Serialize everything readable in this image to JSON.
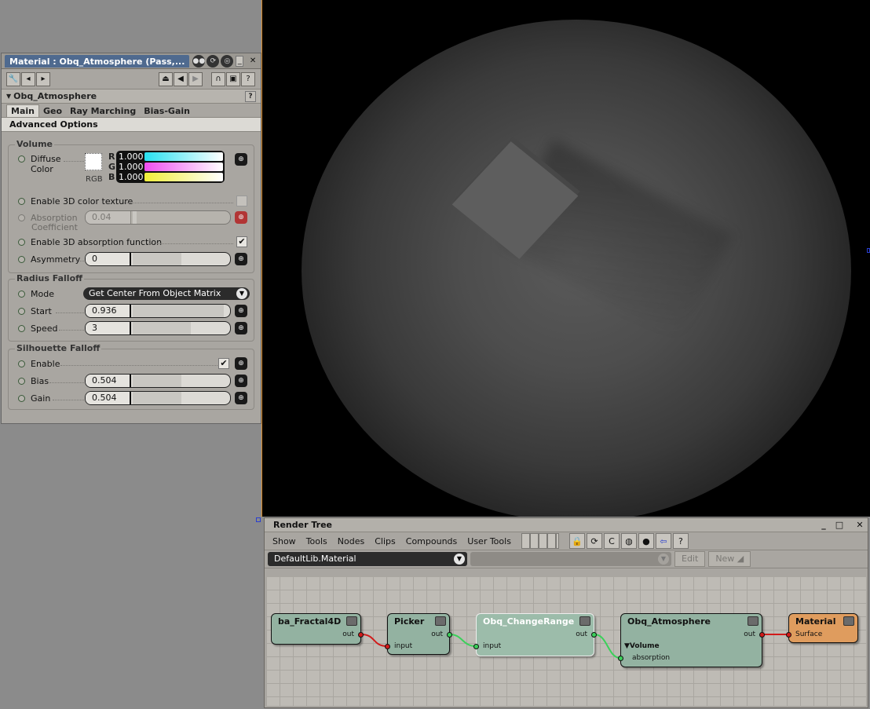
{
  "property_panel": {
    "title": "Material : Obq_Atmosphere (Pass,...",
    "section": "Obq_Atmosphere",
    "tabs": [
      "Main",
      "Geo",
      "Ray Marching",
      "Bias-Gain"
    ],
    "advanced_label": "Advanced Options",
    "volume": {
      "title": "Volume",
      "diffuse_label_1": "Diffuse",
      "diffuse_label_2": "Color",
      "rgb_label": "RGB",
      "channels": [
        {
          "name": "R",
          "value": "1.000",
          "color": "#28e0f0"
        },
        {
          "name": "G",
          "value": "1.000",
          "color": "#ee4ef0"
        },
        {
          "name": "B",
          "value": "1.000",
          "color": "#f0ee38"
        }
      ],
      "enable_3d_texture_label": "Enable 3D color texture",
      "enable_3d_texture_checked": false,
      "absorption_label_1": "Absorption",
      "absorption_label_2": "Coefficient",
      "absorption_value": "0.04",
      "absorption_fraction": 0.04,
      "enable_3d_absorption_label": "Enable 3D absorption function",
      "enable_3d_absorption_checked": true,
      "asymmetry_label": "Asymmetry",
      "asymmetry_value": "0",
      "asymmetry_fraction": 0.5
    },
    "radius_falloff": {
      "title": "Radius Falloff",
      "mode_label": "Mode",
      "mode_value": "Get Center From Object Matrix",
      "start_label": "Start",
      "start_value": "0.936",
      "start_fraction": 0.936,
      "speed_label": "Speed",
      "speed_value": "3",
      "speed_fraction": 0.6
    },
    "silhouette_falloff": {
      "title": "Silhouette Falloff",
      "enable_label": "Enable",
      "enable_checked": true,
      "bias_label": "Bias",
      "bias_value": "0.504",
      "bias_fraction": 0.504,
      "gain_label": "Gain",
      "gain_value": "0.504",
      "gain_fraction": 0.504
    },
    "icons": {
      "checkmark": "✔"
    }
  },
  "render_tree": {
    "title": "Render Tree",
    "menu": [
      "Show",
      "Tools",
      "Nodes",
      "Clips",
      "Compounds",
      "User Tools"
    ],
    "library": "DefaultLib.Material",
    "edit_label": "Edit",
    "new_label": "New",
    "nodes": {
      "fractal": {
        "name": "ba_Fractal4D",
        "out": "out"
      },
      "picker": {
        "name": "Picker",
        "out": "out",
        "in": "input"
      },
      "change_range": {
        "name": "Obq_ChangeRange",
        "out": "out",
        "in": "input"
      },
      "atmosphere": {
        "name": "Obq_Atmosphere",
        "out": "out",
        "group": "▼Volume",
        "in": "absorption"
      },
      "material": {
        "name": "Material",
        "in": "Surface"
      }
    },
    "colors": {
      "link_red": "#d21a1a",
      "link_green": "#3bd05a",
      "node_green": "#93b2a1",
      "node_orange": "#df9c5e"
    }
  }
}
